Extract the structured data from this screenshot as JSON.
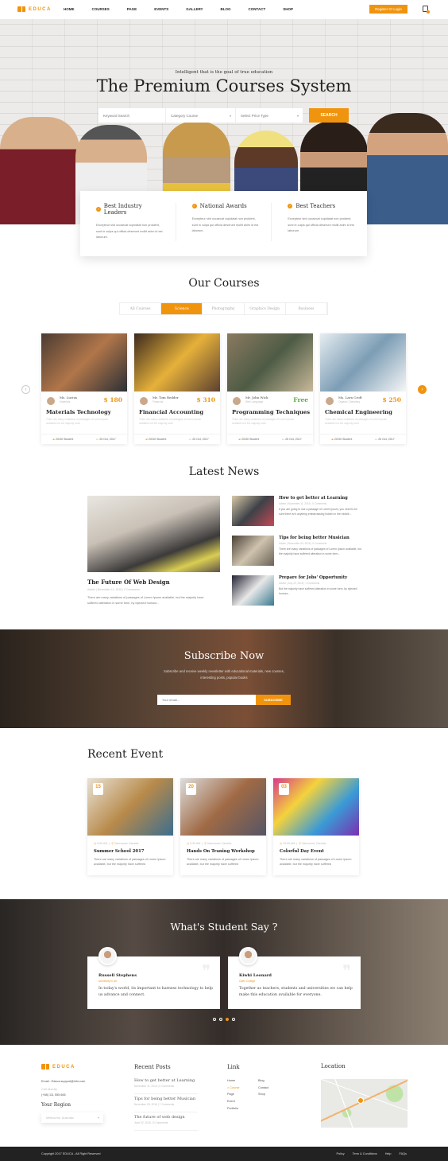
{
  "brand": {
    "name": "EDUCA",
    "accent": "#f0940e"
  },
  "nav": {
    "items": [
      "HOME",
      "COURSES",
      "PAGE",
      "EVENTS",
      "GALLERY",
      "BLOG",
      "CONTACT",
      "SHOP"
    ],
    "register": "Register Or Login",
    "cart_icon": "shopping-bag-icon"
  },
  "hero": {
    "subtitle": "Intelligent that is the goal of true education",
    "title": "The Premium Courses System",
    "keyword_placeholder": "Keyword Search",
    "category": "Category Course",
    "price_type": "Select Price Type",
    "search": "SEARCH"
  },
  "features": [
    {
      "title": "Best Industry Leaders",
      "text": "Excepteur sint occaecat cupidatat non proident, sunt in culpa qui officia deserunt mollit anim id est laborum."
    },
    {
      "title": "National Awards",
      "text": "Excepteur sint occaecat cupidatat non proident, sunt in culpa qui officia deserunt mollit anim id est laborum."
    },
    {
      "title": "Best Teachers",
      "text": "Excepteur sint occaecat cupidatat non proident, sunt in culpa qui officia deserunt mollit anim id est laborum."
    }
  ],
  "courses": {
    "title": "Our Courses",
    "tabs": [
      "All Courses",
      "Science",
      "Photography",
      "Graphics Design",
      "Business"
    ],
    "active_tab": "Science",
    "items": [
      {
        "teacher": "Ms. Lucius",
        "role": "Materials",
        "price": "$ 180",
        "tone": "paid",
        "title": "Materials Technology",
        "desc": "There are many variations of passages of Lorem Ipsum available but the majority have",
        "students": "20/30 Student",
        "date": "25 Oct, 2017"
      },
      {
        "teacher": "Mr. Tom Redder",
        "role": "Financial",
        "price": "$ 310",
        "tone": "paid",
        "title": "Financial Accounting",
        "desc": "There are many variations of passages of Lorem Ipsum available but the majority have",
        "students": "20/30 Student",
        "date": "25 Oct, 2017"
      },
      {
        "teacher": "Mr. John Wick",
        "role": "Web Language",
        "price": "Free",
        "tone": "free",
        "title": "Programming Techniques",
        "desc": "There are many variations of passages of Lorem Ipsum available but the majority have",
        "students": "20/30 Student",
        "date": "25 Oct, 2017"
      },
      {
        "teacher": "Ms. Lara Croft",
        "role": "Organic Chemistry",
        "price": "$ 250",
        "tone": "paid",
        "title": "Chemical Engineering",
        "desc": "There are many variations of passages of Lorem Ipsum available but the majority have",
        "students": "20/30 Student",
        "date": "25 Oct, 2017"
      }
    ]
  },
  "news": {
    "title": "Latest News",
    "featured": {
      "title": "The Future Of Web Design",
      "meta": "Admin  |  November 11, 2016  |  0 Comments",
      "desc": "There are many variations of passages of Lorem Ipsum available, but the majority have suffered alteration in some form, by injected humour..."
    },
    "items": [
      {
        "title": "How to get better at Learning",
        "meta": "Admin  |  November 11, 2016  |  0 Comments",
        "desc": "If you are going to use a passage of Lorem Ipsum, you need to be sure there isn't anything embarrassing hidden in the middle..."
      },
      {
        "title": "Tips for being better Musician",
        "meta": "Admin  |  November 09, 2016  |  0 Comments",
        "desc": "There are many variations of passages of Lorem Ipsum available, but the majority have suffered alteration in some form..."
      },
      {
        "title": "Prepare for Jobs' Opportunity",
        "meta": "Admin  |  July 22, 2016  |  1 Comments",
        "desc": "But the majority have suffered alteration in some form, by injected humour..."
      }
    ]
  },
  "subscribe": {
    "title": "Subscribe Now",
    "desc": "Subscribe and receive weekly newsletter with educational materials, new courses, interesting posts, popular books",
    "placeholder": "Your email...",
    "button": "SUBSCRIBE"
  },
  "events": {
    "title": "Recent Event",
    "items": [
      {
        "day": "15",
        "time": "9:00 AM",
        "place": "Vancouver Canada",
        "title": "Summer School 2017",
        "desc": "There are many variations of passages of Lorem Ipsum available, but the majority have suffered"
      },
      {
        "day": "20",
        "time": "9:30 AM",
        "place": "Vancouver Canada",
        "title": "Hands On Traning Workshop",
        "desc": "There are many variations of passages of Lorem Ipsum available, but the majority have suffered"
      },
      {
        "day": "03",
        "time": "10:00 AM",
        "place": "Vancouver Canada",
        "title": "Colorful Day Event",
        "desc": "There are many variations of passages of Lorem Ipsum available, but the majority have suffered"
      }
    ]
  },
  "testimonials": {
    "title": "What's Student Say ?",
    "items": [
      {
        "name": "Russell Stephens",
        "org": "University in UK",
        "text": "In today's world, its important to harness technology to help us advance and connect."
      },
      {
        "name": "Kiwhi Leonard",
        "org": "Open College",
        "text": "Together as teachers, students and universities we can help make this education available for everyone."
      }
    ],
    "active_dot": 3
  },
  "footer": {
    "email": "Email : Educa.support@info.com",
    "call_label": "Call directly",
    "phone": "(+88) 111 555 666",
    "region_title": "Your Region",
    "region": "Melbourne, Australia",
    "recent_title": "Recent Posts",
    "recent": [
      {
        "title": "How to get better at Learning",
        "meta": "November 11, 2016  |  0 Comments"
      },
      {
        "title": "Tips for being better Musician",
        "meta": "November 09, 2016  |  7 Comments"
      },
      {
        "title": "The future of web design",
        "meta": "June 02, 2016  |  3 Comments"
      }
    ],
    "link_title": "Link",
    "links_col1": [
      "Home",
      "> Course",
      "Page",
      "Event",
      "Portfolio"
    ],
    "links_col2": [
      "Blog",
      "Contact",
      "Shop"
    ],
    "location_title": "Location",
    "copyright": "Copyright 2017 EDUCA - All Right Reserved",
    "bottom_links": [
      "Policy",
      "Term & Conditions",
      "Help",
      "FAQs"
    ]
  }
}
